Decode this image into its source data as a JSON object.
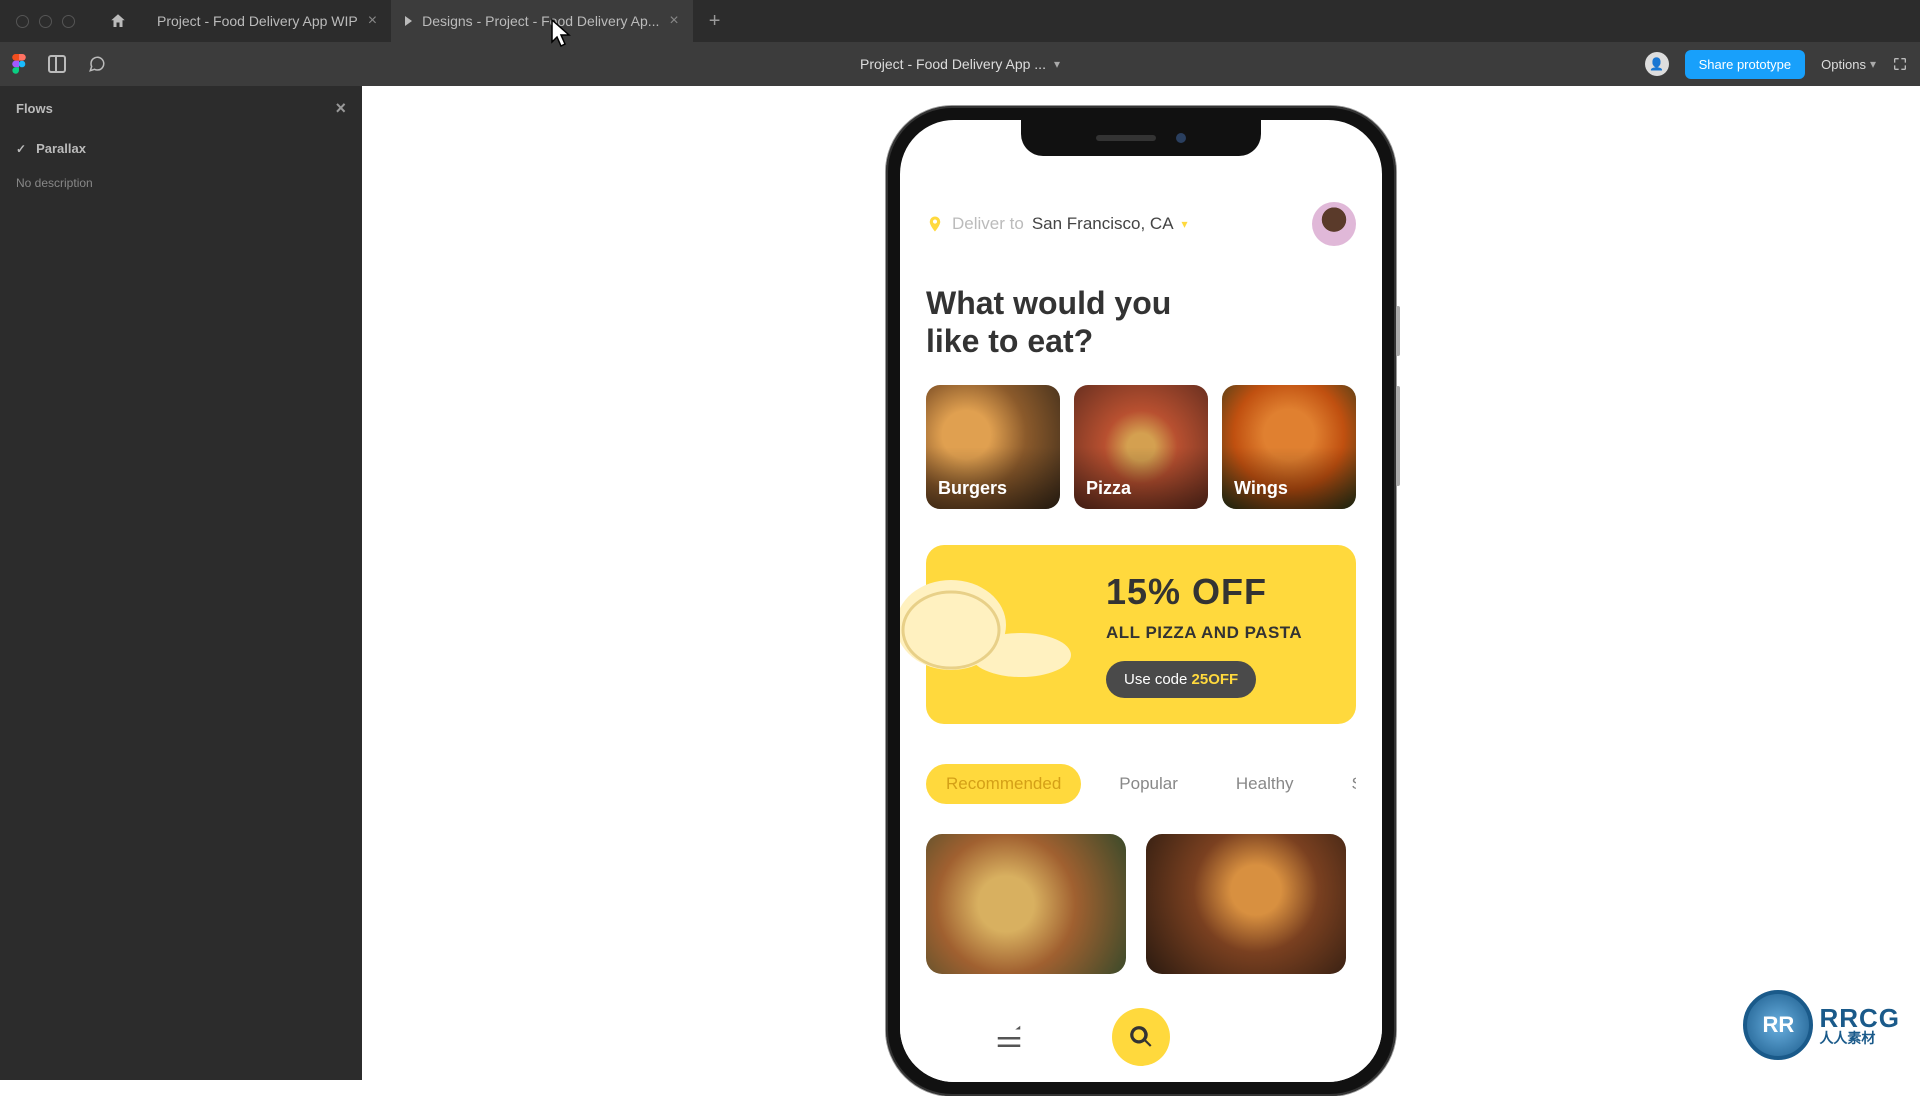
{
  "titlebar": {
    "tabs": [
      {
        "label": "Project - Food Delivery App WIP",
        "active": false,
        "hasPlay": false
      },
      {
        "label": "Designs - Project - Food Delivery Ap...",
        "active": true,
        "hasPlay": true
      }
    ]
  },
  "toolbar": {
    "title": "Project - Food Delivery App ...",
    "share": "Share prototype",
    "options": "Options"
  },
  "sidebar": {
    "title": "Flows",
    "flow": "Parallax",
    "nodesc": "No description"
  },
  "app": {
    "deliver_to": "Deliver to",
    "city": "San Francisco, CA",
    "headline_l1": "What would you",
    "headline_l2": "like to eat?",
    "categories": [
      "Burgers",
      "Pizza",
      "Wings"
    ],
    "promo": {
      "title": "15% OFF",
      "subtitle": "ALL PIZZA AND PASTA",
      "button_prefix": "Use code ",
      "button_code": "25OFF"
    },
    "filters": [
      "Recommended",
      "Popular",
      "Healthy",
      "Sa"
    ]
  },
  "watermark": "RRCG",
  "logo": {
    "abbr": "RR",
    "line1": "RRCG",
    "line2": "人人素材"
  }
}
